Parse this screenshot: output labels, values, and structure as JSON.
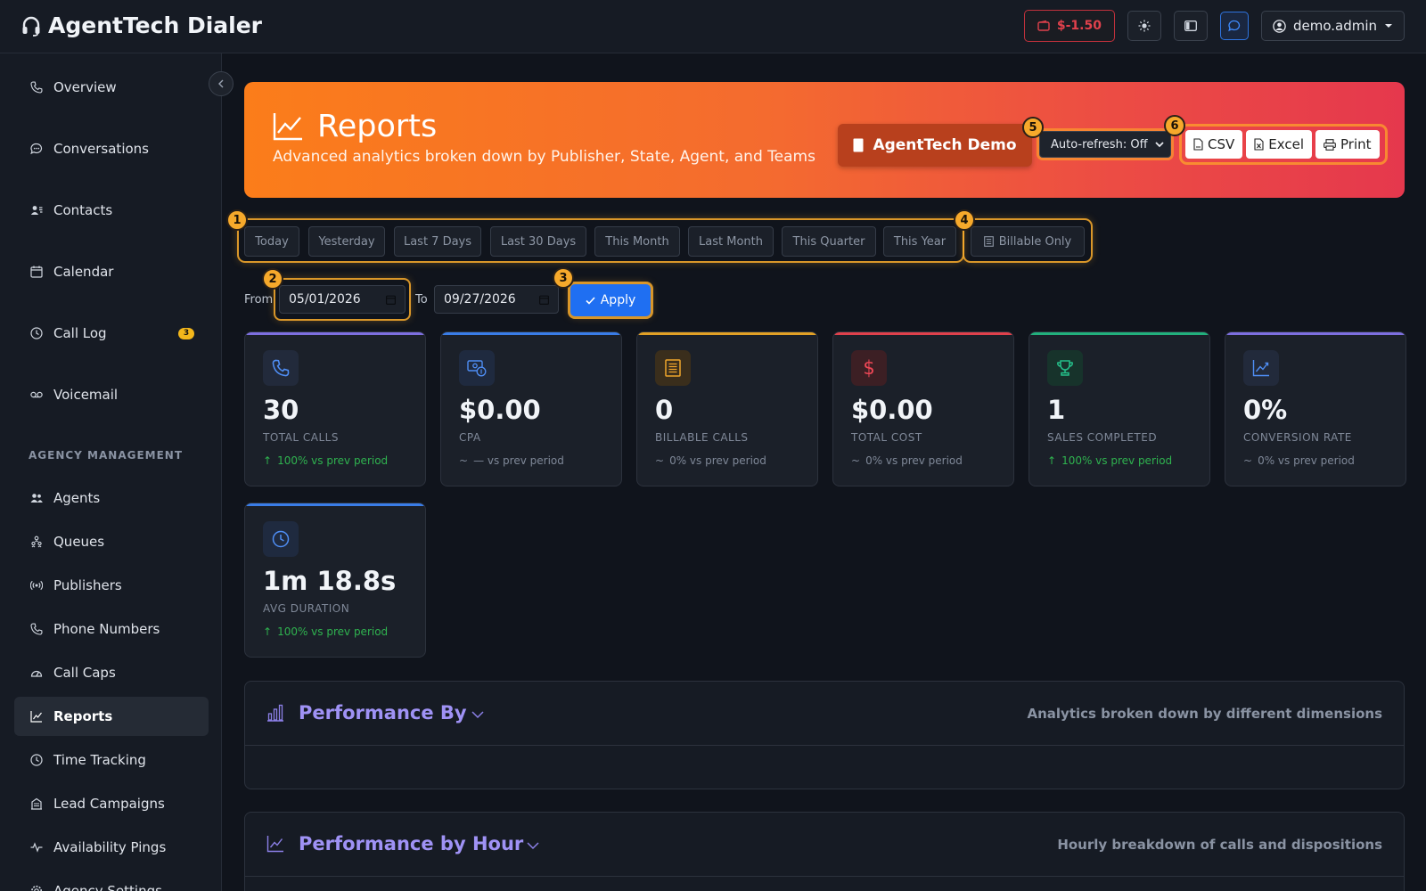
{
  "app": {
    "title": "AgentTech Dialer"
  },
  "topbar": {
    "balance": "$-1.50",
    "user": "demo.admin"
  },
  "sidebar": {
    "items": [
      {
        "label": "Overview",
        "icon": "phone-icon"
      },
      {
        "label": "Conversations",
        "icon": "chat-icon"
      },
      {
        "label": "Contacts",
        "icon": "contacts-icon"
      },
      {
        "label": "Calendar",
        "icon": "calendar-icon"
      },
      {
        "label": "Call Log",
        "icon": "clock-icon",
        "badge": "3"
      },
      {
        "label": "Voicemail",
        "icon": "voicemail-icon"
      }
    ],
    "section_label": "AGENCY MANAGEMENT",
    "agency_items": [
      {
        "label": "Agents",
        "icon": "users-icon"
      },
      {
        "label": "Queues",
        "icon": "queue-icon"
      },
      {
        "label": "Publishers",
        "icon": "broadcast-icon"
      },
      {
        "label": "Phone Numbers",
        "icon": "phone-icon"
      },
      {
        "label": "Call Caps",
        "icon": "gauge-icon"
      },
      {
        "label": "Reports",
        "icon": "chart-icon",
        "active": true
      },
      {
        "label": "Time Tracking",
        "icon": "clock-icon"
      },
      {
        "label": "Lead Campaigns",
        "icon": "building-icon"
      },
      {
        "label": "Availability Pings",
        "icon": "pulse-icon"
      },
      {
        "label": "Agency Settings",
        "icon": "gear-icon"
      }
    ]
  },
  "hero": {
    "title": "Reports",
    "subtitle": "Advanced analytics broken down by Publisher, State, Agent, and Teams",
    "agency": "AgentTech Demo",
    "auto_refresh": "Auto-refresh: Off",
    "exports": [
      "CSV",
      "Excel",
      "Print"
    ]
  },
  "markers": [
    "1",
    "2",
    "3",
    "4",
    "5",
    "6"
  ],
  "ranges": [
    "Today",
    "Yesterday",
    "Last 7 Days",
    "Last 30 Days",
    "This Month",
    "Last Month",
    "This Quarter",
    "This Year"
  ],
  "billable_only": "Billable Only",
  "filters": {
    "from_label": "From",
    "from": "05/01/2026",
    "to_label": "To",
    "to": "09/27/2026",
    "apply": "Apply"
  },
  "stats": [
    {
      "value": "30",
      "label": "TOTAL CALLS",
      "trend": "100% vs prev period",
      "trend_dir": "up",
      "color": "#7d6fe0",
      "icon": "phone-icon"
    },
    {
      "value": "$0.00",
      "label": "CPA",
      "trend": "— vs prev period",
      "trend_dir": "flat",
      "color": "#3a7de8",
      "icon": "money-icon"
    },
    {
      "value": "0",
      "label": "BILLABLE CALLS",
      "trend": "0% vs prev period",
      "trend_dir": "flat",
      "color": "#e2a126",
      "icon": "receipt-icon"
    },
    {
      "value": "$0.00",
      "label": "TOTAL COST",
      "trend": "0% vs prev period",
      "trend_dir": "flat",
      "color": "#e0414c",
      "icon": "dollar-icon"
    },
    {
      "value": "1",
      "label": "SALES COMPLETED",
      "trend": "100% vs prev period",
      "trend_dir": "up",
      "color": "#22b07d",
      "icon": "trophy-icon"
    },
    {
      "value": "0%",
      "label": "CONVERSION RATE",
      "trend": "0% vs prev period",
      "trend_dir": "flat",
      "color": "#7d6fe0",
      "icon": "chart-icon"
    },
    {
      "value": "1m 18.8s",
      "label": "AVG DURATION",
      "trend": "100% vs prev period",
      "trend_dir": "up",
      "color": "#3a7de8",
      "icon": "clock-icon"
    }
  ],
  "sections": [
    {
      "title": "Performance By",
      "desc": "Analytics broken down by different dimensions"
    },
    {
      "title": "Performance by Hour",
      "desc": "Hourly breakdown of calls and dispositions"
    }
  ]
}
